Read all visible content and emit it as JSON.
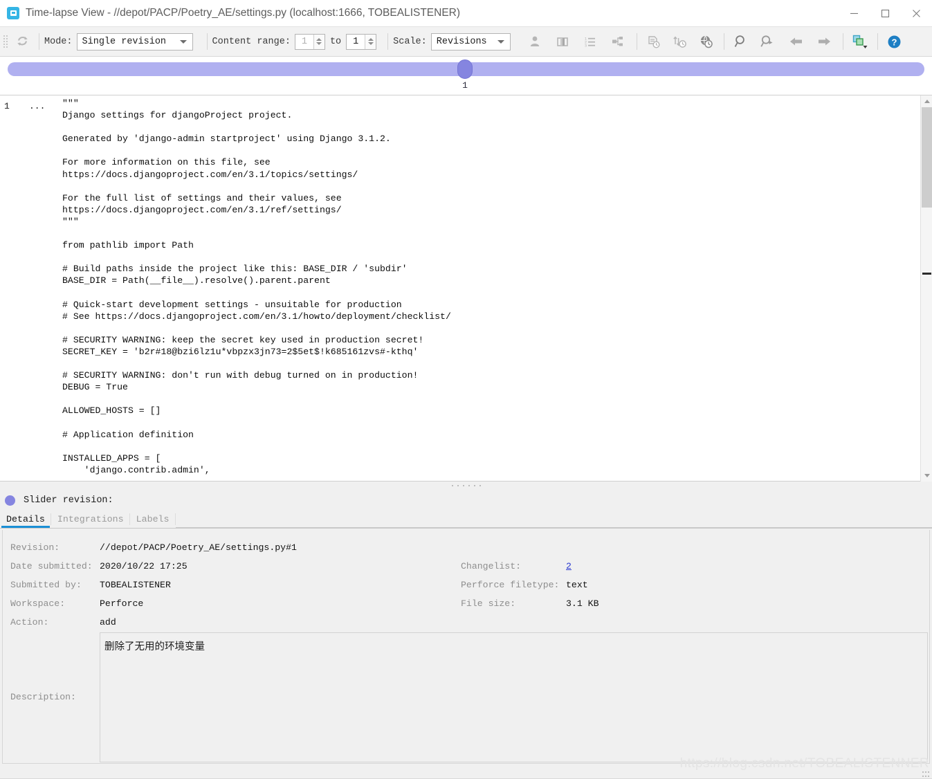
{
  "window": {
    "title": "Time-lapse View - //depot/PACP/Poetry_AE/settings.py (localhost:1666, TOBEALISTENER)",
    "app_icon": "perforce-app-icon",
    "minimize": "—",
    "maximize": "□",
    "close": "✕"
  },
  "toolbar": {
    "refresh_icon": "refresh-icon",
    "mode_label": "Mode:",
    "mode_value": "Single revision",
    "content_range_label": "Content range:",
    "content_range_from": "1",
    "content_range_to_label": "to",
    "content_range_to": "1",
    "scale_label": "Scale:",
    "scale_value": "Revisions",
    "icons": [
      "user-icon",
      "columns-icon",
      "numbered-list-icon",
      "branch-icon",
      "file-history-icon",
      "revision-graph-icon",
      "globe-history-icon",
      "find-icon",
      "find-next-icon",
      "back-arrow-icon",
      "forward-arrow-icon",
      "copy-layers-icon",
      "help-icon"
    ]
  },
  "slider": {
    "value": "1",
    "min_label": "",
    "max_label": ""
  },
  "code": {
    "line_number": "1",
    "fold_marker": "...",
    "content": "\"\"\"\nDjango settings for djangoProject project.\n\nGenerated by 'django-admin startproject' using Django 3.1.2.\n\nFor more information on this file, see\nhttps://docs.djangoproject.com/en/3.1/topics/settings/\n\nFor the full list of settings and their values, see\nhttps://docs.djangoproject.com/en/3.1/ref/settings/\n\"\"\"\n\nfrom pathlib import Path\n\n# Build paths inside the project like this: BASE_DIR / 'subdir'\nBASE_DIR = Path(__file__).resolve().parent.parent\n\n# Quick-start development settings - unsuitable for production\n# See https://docs.djangoproject.com/en/3.1/howto/deployment/checklist/\n\n# SECURITY WARNING: keep the secret key used in production secret!\nSECRET_KEY = 'b2r#18@bzi6lz1u*vbpzx3jn73=2$5et$!k685161zvs#-kthq'\n\n# SECURITY WARNING: don't run with debug turned on in production!\nDEBUG = True\n\nALLOWED_HOSTS = []\n\n# Application definition\n\nINSTALLED_APPS = [\n    'django.contrib.admin',"
  },
  "revision_header": {
    "label": "Slider revision:",
    "dot_color": "#8585e0"
  },
  "tabs": [
    {
      "label": "Details",
      "active": true
    },
    {
      "label": "Integrations",
      "active": false
    },
    {
      "label": "Labels",
      "active": false
    }
  ],
  "details": {
    "left": [
      {
        "label": "Revision:",
        "value": "//depot/PACP/Poetry_AE/settings.py#1"
      },
      {
        "label": "Date submitted:",
        "value": "2020/10/22 17:25"
      },
      {
        "label": "Submitted by:",
        "value": "TOBEALISTENER"
      },
      {
        "label": "Workspace:",
        "value": "Perforce"
      },
      {
        "label": "Action:",
        "value": "add"
      }
    ],
    "right": [
      {
        "label": "Changelist:",
        "value": "2",
        "link": true
      },
      {
        "label": "Perforce filetype:",
        "value": "text",
        "link": false
      },
      {
        "label": "File size:",
        "value": "3.1 KB",
        "link": false
      }
    ],
    "description_label": "Description:",
    "description_value": "删除了无用的环境变量"
  },
  "watermark": "https://blog.csdn.net/TOBEALISTENNER",
  "colors": {
    "accent_tab": "#1a8fd6",
    "slider_track": "#b0b0f0",
    "slider_handle": "#8585e0",
    "link": "#2b3ad0",
    "toolbar_bg": "#f2f2f2",
    "panel_bg": "#f0f0f0"
  }
}
